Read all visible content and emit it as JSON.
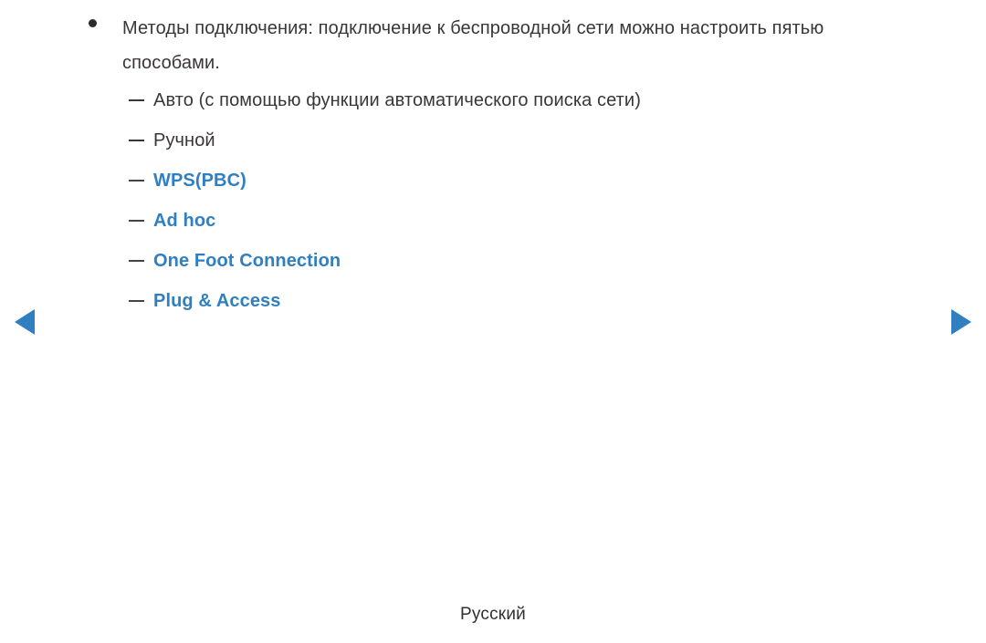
{
  "colors": {
    "background": "#ffffff",
    "body_text": "#3b3539",
    "link_blue": "#2f7fc1",
    "arrow_blue": "#2f7fc1",
    "marker": "#2f2a2d"
  },
  "content": {
    "bullet": {
      "marker": "bullet-dot",
      "text": "Методы подключения: подключение к беспроводной сети можно настроить пятью способами."
    },
    "sub_items": [
      {
        "marker": "en-dash",
        "label": "Авто (с помощью функции автоматического поиска сети)",
        "is_link": false
      },
      {
        "marker": "en-dash",
        "label": "Ручной",
        "is_link": false
      },
      {
        "marker": "en-dash",
        "label": "WPS(PBC)",
        "is_link": true
      },
      {
        "marker": "en-dash",
        "label": "Ad hoc",
        "is_link": true
      },
      {
        "marker": "en-dash",
        "label": "One Foot Connection",
        "is_link": true
      },
      {
        "marker": "en-dash",
        "label": "Plug & Access",
        "is_link": true
      }
    ]
  },
  "navigation": {
    "prev": {
      "icon": "triangle-left-icon",
      "label": ""
    },
    "next": {
      "icon": "triangle-right-icon",
      "label": ""
    }
  },
  "footer": {
    "language": "Русский"
  }
}
